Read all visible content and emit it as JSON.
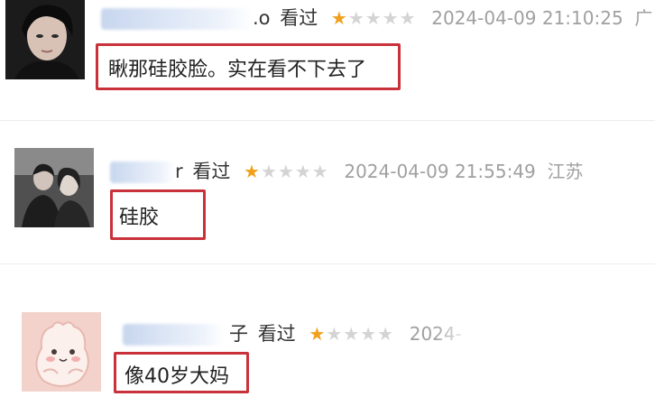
{
  "comments": [
    {
      "username_tail": ".o",
      "watched": "看过",
      "rating_stars": 1,
      "rating_max": 5,
      "time": "2024-04-09 21:10:25",
      "location": "广",
      "body": "瞅那硅胶脸。实在看不下去了"
    },
    {
      "username_tail": "r",
      "watched": "看过",
      "rating_stars": 1,
      "rating_max": 5,
      "time": "2024-04-09 21:55:49",
      "location": "江苏",
      "body": "硅胶"
    },
    {
      "username_tail": "子",
      "watched": "看过",
      "rating_stars": 1,
      "rating_max": 5,
      "time": "2024-",
      "body": "像40岁大妈"
    }
  ],
  "colors": {
    "star": "#f0a01a",
    "highlight_box": "#c9323a",
    "muted_text": "#a0a0a0"
  }
}
